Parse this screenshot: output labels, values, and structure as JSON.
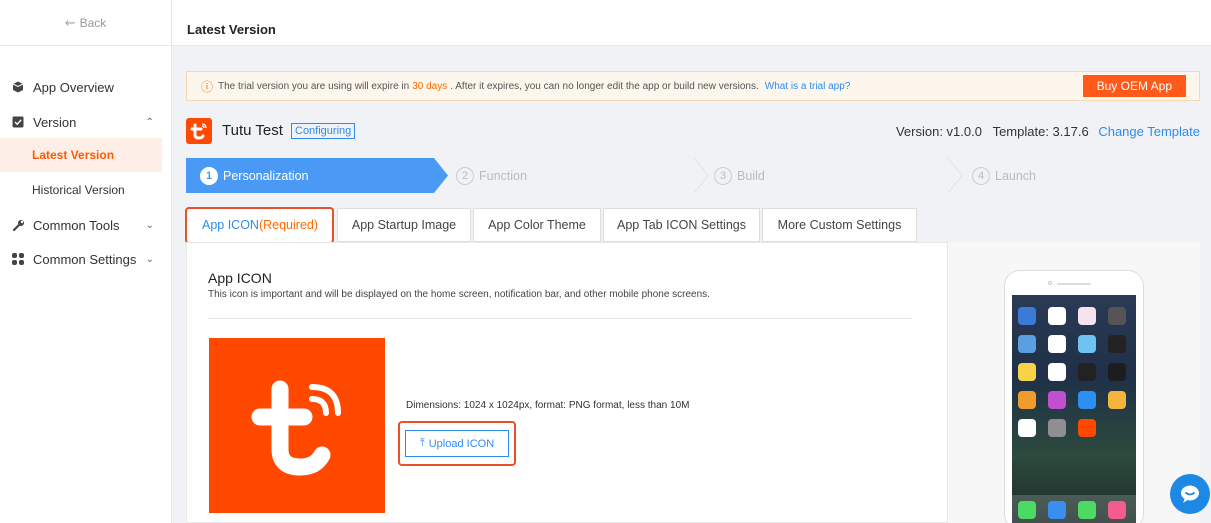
{
  "topbar": {
    "back_label": "Back",
    "title": "Latest Version"
  },
  "sidebar": {
    "items": [
      {
        "label": "App Overview",
        "icon": "cube-icon"
      },
      {
        "label": "Version",
        "icon": "checkbox-icon",
        "expanded": true
      },
      {
        "label": "Common Tools",
        "icon": "wrench-icon",
        "expanded": false
      },
      {
        "label": "Common Settings",
        "icon": "grid-icon",
        "expanded": false
      }
    ],
    "version_sub": [
      "Latest Version",
      "Historical Version"
    ]
  },
  "notice": {
    "text_before": "The trial version you are using will expire in",
    "days": "30 days",
    "text_after": ". After it expires, you can no longer edit the app or build new versions.",
    "link": "What is a trial app?",
    "buy_label": "Buy OEM App"
  },
  "app": {
    "name": "Tutu Test",
    "status": "Configuring",
    "version": "Version: v1.0.0",
    "template": "Template: 3.17.6",
    "change_template": "Change Template"
  },
  "steps": [
    {
      "num": "1",
      "label": "Personalization",
      "active": true
    },
    {
      "num": "2",
      "label": "Function",
      "active": false
    },
    {
      "num": "3",
      "label": "Build",
      "active": false
    },
    {
      "num": "4",
      "label": "Launch",
      "active": false
    }
  ],
  "tabs": [
    {
      "label": "App ICON",
      "suffix": "(Required)",
      "active": true
    },
    {
      "label": "App Startup Image"
    },
    {
      "label": "App Color Theme"
    },
    {
      "label": "App Tab ICON Settings"
    },
    {
      "label": "More Custom Settings"
    }
  ],
  "panel": {
    "title": "App ICON",
    "description": "This icon is important and will be displayed on the home screen, notification bar, and other mobile phone screens.",
    "dimensions": "Dimensions: 1024 x 1024px, format: PNG format, less than 10M",
    "upload_label": "Upload ICON"
  },
  "colors": {
    "brand": "#ff4800",
    "accent": "#2d8cf0",
    "step_active": "#4a9af5",
    "highlight": "#e8502b"
  }
}
